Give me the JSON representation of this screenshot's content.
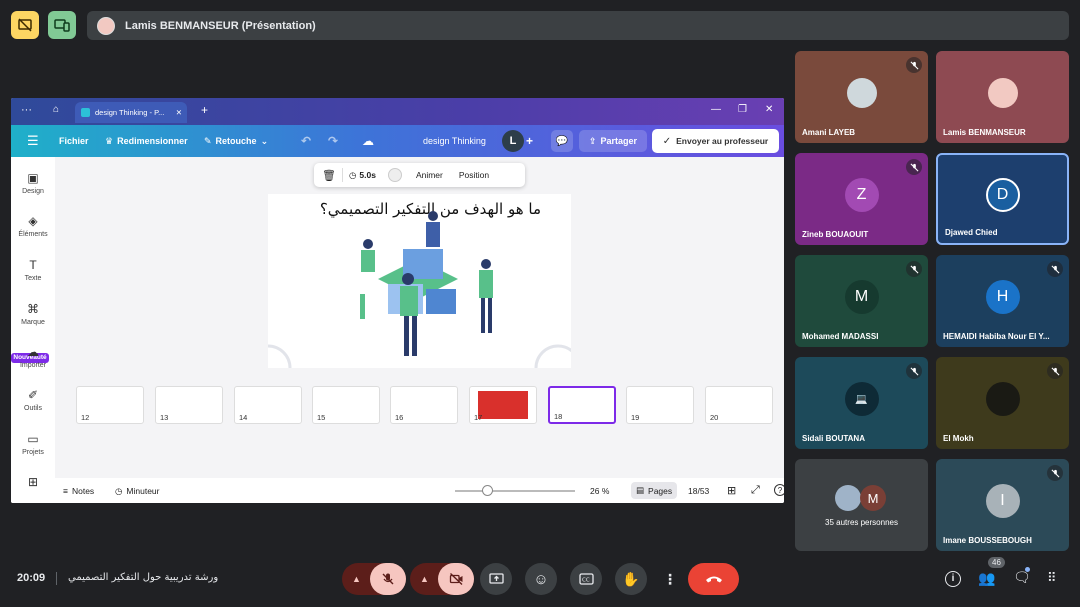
{
  "top": {
    "presenter_label": "Lamis BENMANSEUR (Présentation)"
  },
  "browser": {
    "tab_title": "design Thinking - P..."
  },
  "canva": {
    "menu_fichier": "Fichier",
    "menu_redimensionner": "Redimensionner",
    "menu_retouche": "Retouche",
    "doc_title": "design Thinking",
    "user_initial": "L",
    "share_label": "Partager",
    "send_label": "Envoyer au professeur",
    "sidebar": [
      {
        "label": "Design"
      },
      {
        "label": "Éléments"
      },
      {
        "label": "Texte"
      },
      {
        "label": "Marque"
      },
      {
        "label": "Importer"
      },
      {
        "label": "Outils"
      },
      {
        "label": "Projets"
      }
    ],
    "new_badge": "Nouveauté",
    "ctx": {
      "duration": "5.0s",
      "animate": "Animer",
      "position": "Position"
    },
    "slide_title": "ما هو الهدف من التفكير التصميمي؟",
    "thumbs": [
      "12",
      "13",
      "14",
      "15",
      "16",
      "17",
      "18",
      "19",
      "20"
    ],
    "selected_thumb": "18",
    "bottom": {
      "notes": "Notes",
      "timer": "Minuteur",
      "zoom": "26 %",
      "pages": "Pages",
      "page_count": "18/53"
    }
  },
  "participants": [
    {
      "name": "Amani LAYEB",
      "initial": "",
      "color": "#7a4a3c",
      "muted": true
    },
    {
      "name": "Lamis BENMANSEUR",
      "initial": "",
      "color": "#8e4a52",
      "muted": false
    },
    {
      "name": "Zineb BOUAOUIT",
      "initial": "Z",
      "color": "#7b2a86",
      "muted": true
    },
    {
      "name": "Djawed Chied",
      "initial": "D",
      "color": "#1d3f6e",
      "muted": false
    },
    {
      "name": "Mohamed MADASSI",
      "initial": "M",
      "color": "#1f4a3c",
      "muted": true
    },
    {
      "name": "HEMAIDI Habiba Nour El Y...",
      "initial": "H",
      "color": "#1c3f5e",
      "muted": true
    },
    {
      "name": "Sidali BOUTANA",
      "initial": "",
      "color": "#1d4a5a",
      "muted": true
    },
    {
      "name": "El Mokh",
      "initial": "",
      "color": "#3e3a1c",
      "muted": true
    },
    {
      "name": "35 autres personnes",
      "initial": "M",
      "color": "#3c4043",
      "muted": false
    },
    {
      "name": "Imane BOUSSEBOUGH",
      "initial": "I",
      "color": "#2c4a58",
      "muted": true
    }
  ],
  "footer": {
    "time": "20:09",
    "meeting_title": "ورشة تدريبية حول التفكير التصميمي",
    "people_count": "46"
  },
  "colors": {
    "end_call": "#ea4335",
    "muted_bg": "#f6c6c0"
  }
}
